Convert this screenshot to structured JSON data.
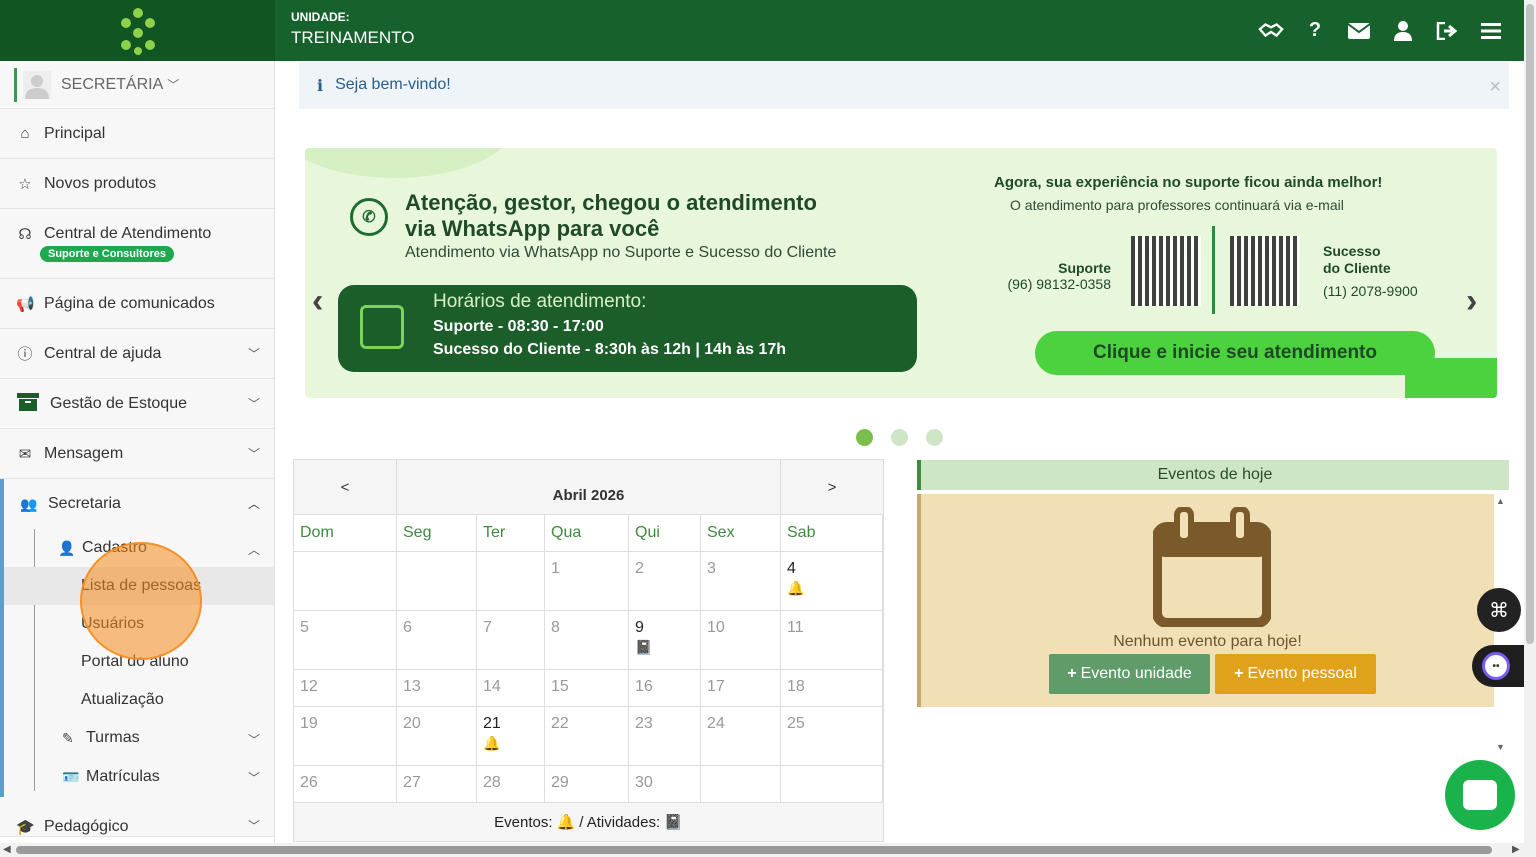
{
  "header": {
    "unit_label": "UNIDADE:",
    "unit_value": "TREINAMENTO"
  },
  "user": {
    "role": "SECRETÁRIA"
  },
  "menu": {
    "principal": "Principal",
    "novos": "Novos produtos",
    "central": "Central de Atendimento",
    "central_badge": "Suporte e Consultores",
    "comunicados": "Página de comunicados",
    "ajuda": "Central de ajuda",
    "estoque": "Gestão de Estoque",
    "mensagem": "Mensagem",
    "secretaria": "Secretaria",
    "cadastro": "Cadastro",
    "lista": "Lista de pessoas",
    "usuarios": "Usuários",
    "portal": "Portal do aluno",
    "atualizacao": "Atualização",
    "turmas": "Turmas",
    "matriculas": "Matrículas",
    "pedagogico": "Pedagógico"
  },
  "alert": {
    "text": "Seja bem-vindo!"
  },
  "banner": {
    "title": "Atenção, gestor, chegou o atendimento via WhatsApp para você",
    "subtitle": "Atendimento via WhatsApp no Suporte e Sucesso do Cliente",
    "hours_title": "Horários de atendimento:",
    "hours_1": "Suporte - 08:30 - 17:00",
    "hours_2": "Sucesso do Cliente - 8:30h às 12h | 14h às 17h",
    "right_title": "Agora, sua experiência no suporte ficou ainda melhor!",
    "right_sub": "O atendimento para professores continuará via e-mail",
    "sup_label": "Suporte",
    "sup_phone": "(96) 98132-0358",
    "suc_label_1": "Sucesso",
    "suc_label_2": "do Cliente",
    "suc_phone": "(11) 2078-9900",
    "cta": "Clique e inicie seu atendimento"
  },
  "calendar": {
    "prev": "<",
    "next": ">",
    "month": "Abril 2026",
    "days": [
      "Dom",
      "Seg",
      "Ter",
      "Qua",
      "Qui",
      "Sex",
      "Sab"
    ],
    "footer_events": "Eventos:",
    "footer_acts": "/ Atividades:"
  },
  "events": {
    "title": "Eventos de hoje",
    "empty": "Nenhum evento para hoje!",
    "btn_unit": "Evento unidade",
    "btn_personal": "Evento pessoal"
  },
  "colors": {
    "header_green": "#17612c",
    "accent_green": "#1ea84f",
    "highlight_orange": "#f68c1e",
    "events_bg": "#f1e0b6",
    "btn_personal": "#e0a21a"
  }
}
